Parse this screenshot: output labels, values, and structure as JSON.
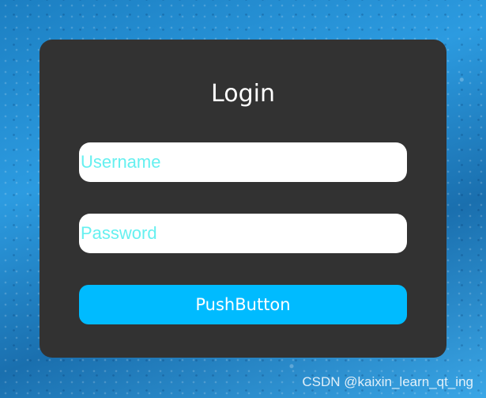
{
  "login": {
    "title": "Login",
    "username_placeholder": "Username",
    "password_placeholder": "Password",
    "button_label": "PushButton"
  },
  "watermark": "CSDN @kaixin_learn_qt_ing",
  "colors": {
    "card": "#323232",
    "button": "#00bbff",
    "placeholder": "#66f0f0",
    "field": "#ffffff"
  }
}
